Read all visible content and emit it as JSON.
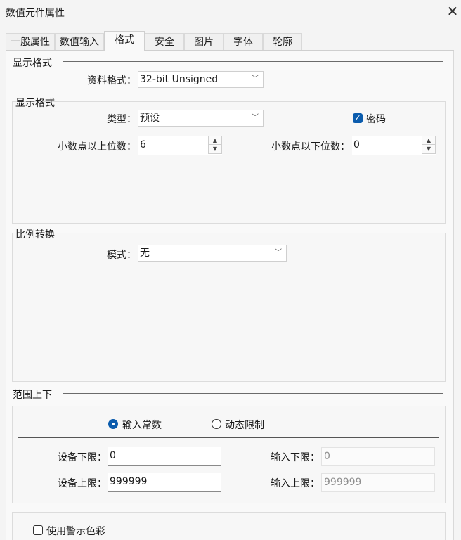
{
  "window": {
    "title": "数值元件属性",
    "close_icon": "close-icon"
  },
  "tabs": [
    {
      "label": "一般属性",
      "active": false
    },
    {
      "label": "数值输入",
      "active": false
    },
    {
      "label": "格式",
      "active": true
    },
    {
      "label": "安全",
      "active": false
    },
    {
      "label": "图片",
      "active": false
    },
    {
      "label": "字体",
      "active": false
    },
    {
      "label": "轮廓",
      "active": false
    }
  ],
  "display_format": {
    "section_title": "显示格式",
    "data_format_label": "资料格式：",
    "data_format_value": "32-bit Unsigned"
  },
  "display_format_group": {
    "title": "显示格式",
    "type_label": "类型：",
    "type_value": "预设",
    "password_label": "密码",
    "password_checked": true,
    "int_digits_label": "小数点以上位数：",
    "int_digits_value": "6",
    "frac_digits_label": "小数点以下位数：",
    "frac_digits_value": "0"
  },
  "scaling": {
    "title": "比例转换",
    "mode_label": "模式：",
    "mode_value": "无"
  },
  "range": {
    "section_title": "范围上下",
    "option_constant": "输入常数",
    "option_dynamic": "动态限制",
    "selected": "输入常数",
    "device_low_label": "设备下限：",
    "device_low_value": "0",
    "device_high_label": "设备上限：",
    "device_high_value": "999999",
    "input_low_label": "输入下限：",
    "input_low_value": "0",
    "input_high_label": "输入上限：",
    "input_high_value": "999999"
  },
  "warning": {
    "label": "使用警示色彩",
    "checked": false
  },
  "colors": {
    "accent": "#0b5cad",
    "background": "#f4f4f4"
  }
}
